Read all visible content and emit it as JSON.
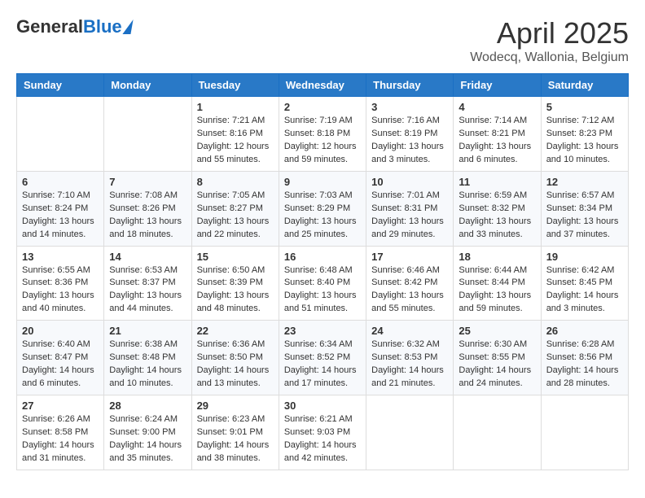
{
  "header": {
    "logo_general": "General",
    "logo_blue": "Blue",
    "month_title": "April 2025",
    "location": "Wodecq, Wallonia, Belgium"
  },
  "days_of_week": [
    "Sunday",
    "Monday",
    "Tuesday",
    "Wednesday",
    "Thursday",
    "Friday",
    "Saturday"
  ],
  "weeks": [
    [
      {
        "day": "",
        "content": ""
      },
      {
        "day": "",
        "content": ""
      },
      {
        "day": "1",
        "content": "Sunrise: 7:21 AM\nSunset: 8:16 PM\nDaylight: 12 hours and 55 minutes."
      },
      {
        "day": "2",
        "content": "Sunrise: 7:19 AM\nSunset: 8:18 PM\nDaylight: 12 hours and 59 minutes."
      },
      {
        "day": "3",
        "content": "Sunrise: 7:16 AM\nSunset: 8:19 PM\nDaylight: 13 hours and 3 minutes."
      },
      {
        "day": "4",
        "content": "Sunrise: 7:14 AM\nSunset: 8:21 PM\nDaylight: 13 hours and 6 minutes."
      },
      {
        "day": "5",
        "content": "Sunrise: 7:12 AM\nSunset: 8:23 PM\nDaylight: 13 hours and 10 minutes."
      }
    ],
    [
      {
        "day": "6",
        "content": "Sunrise: 7:10 AM\nSunset: 8:24 PM\nDaylight: 13 hours and 14 minutes."
      },
      {
        "day": "7",
        "content": "Sunrise: 7:08 AM\nSunset: 8:26 PM\nDaylight: 13 hours and 18 minutes."
      },
      {
        "day": "8",
        "content": "Sunrise: 7:05 AM\nSunset: 8:27 PM\nDaylight: 13 hours and 22 minutes."
      },
      {
        "day": "9",
        "content": "Sunrise: 7:03 AM\nSunset: 8:29 PM\nDaylight: 13 hours and 25 minutes."
      },
      {
        "day": "10",
        "content": "Sunrise: 7:01 AM\nSunset: 8:31 PM\nDaylight: 13 hours and 29 minutes."
      },
      {
        "day": "11",
        "content": "Sunrise: 6:59 AM\nSunset: 8:32 PM\nDaylight: 13 hours and 33 minutes."
      },
      {
        "day": "12",
        "content": "Sunrise: 6:57 AM\nSunset: 8:34 PM\nDaylight: 13 hours and 37 minutes."
      }
    ],
    [
      {
        "day": "13",
        "content": "Sunrise: 6:55 AM\nSunset: 8:36 PM\nDaylight: 13 hours and 40 minutes."
      },
      {
        "day": "14",
        "content": "Sunrise: 6:53 AM\nSunset: 8:37 PM\nDaylight: 13 hours and 44 minutes."
      },
      {
        "day": "15",
        "content": "Sunrise: 6:50 AM\nSunset: 8:39 PM\nDaylight: 13 hours and 48 minutes."
      },
      {
        "day": "16",
        "content": "Sunrise: 6:48 AM\nSunset: 8:40 PM\nDaylight: 13 hours and 51 minutes."
      },
      {
        "day": "17",
        "content": "Sunrise: 6:46 AM\nSunset: 8:42 PM\nDaylight: 13 hours and 55 minutes."
      },
      {
        "day": "18",
        "content": "Sunrise: 6:44 AM\nSunset: 8:44 PM\nDaylight: 13 hours and 59 minutes."
      },
      {
        "day": "19",
        "content": "Sunrise: 6:42 AM\nSunset: 8:45 PM\nDaylight: 14 hours and 3 minutes."
      }
    ],
    [
      {
        "day": "20",
        "content": "Sunrise: 6:40 AM\nSunset: 8:47 PM\nDaylight: 14 hours and 6 minutes."
      },
      {
        "day": "21",
        "content": "Sunrise: 6:38 AM\nSunset: 8:48 PM\nDaylight: 14 hours and 10 minutes."
      },
      {
        "day": "22",
        "content": "Sunrise: 6:36 AM\nSunset: 8:50 PM\nDaylight: 14 hours and 13 minutes."
      },
      {
        "day": "23",
        "content": "Sunrise: 6:34 AM\nSunset: 8:52 PM\nDaylight: 14 hours and 17 minutes."
      },
      {
        "day": "24",
        "content": "Sunrise: 6:32 AM\nSunset: 8:53 PM\nDaylight: 14 hours and 21 minutes."
      },
      {
        "day": "25",
        "content": "Sunrise: 6:30 AM\nSunset: 8:55 PM\nDaylight: 14 hours and 24 minutes."
      },
      {
        "day": "26",
        "content": "Sunrise: 6:28 AM\nSunset: 8:56 PM\nDaylight: 14 hours and 28 minutes."
      }
    ],
    [
      {
        "day": "27",
        "content": "Sunrise: 6:26 AM\nSunset: 8:58 PM\nDaylight: 14 hours and 31 minutes."
      },
      {
        "day": "28",
        "content": "Sunrise: 6:24 AM\nSunset: 9:00 PM\nDaylight: 14 hours and 35 minutes."
      },
      {
        "day": "29",
        "content": "Sunrise: 6:23 AM\nSunset: 9:01 PM\nDaylight: 14 hours and 38 minutes."
      },
      {
        "day": "30",
        "content": "Sunrise: 6:21 AM\nSunset: 9:03 PM\nDaylight: 14 hours and 42 minutes."
      },
      {
        "day": "",
        "content": ""
      },
      {
        "day": "",
        "content": ""
      },
      {
        "day": "",
        "content": ""
      }
    ]
  ]
}
